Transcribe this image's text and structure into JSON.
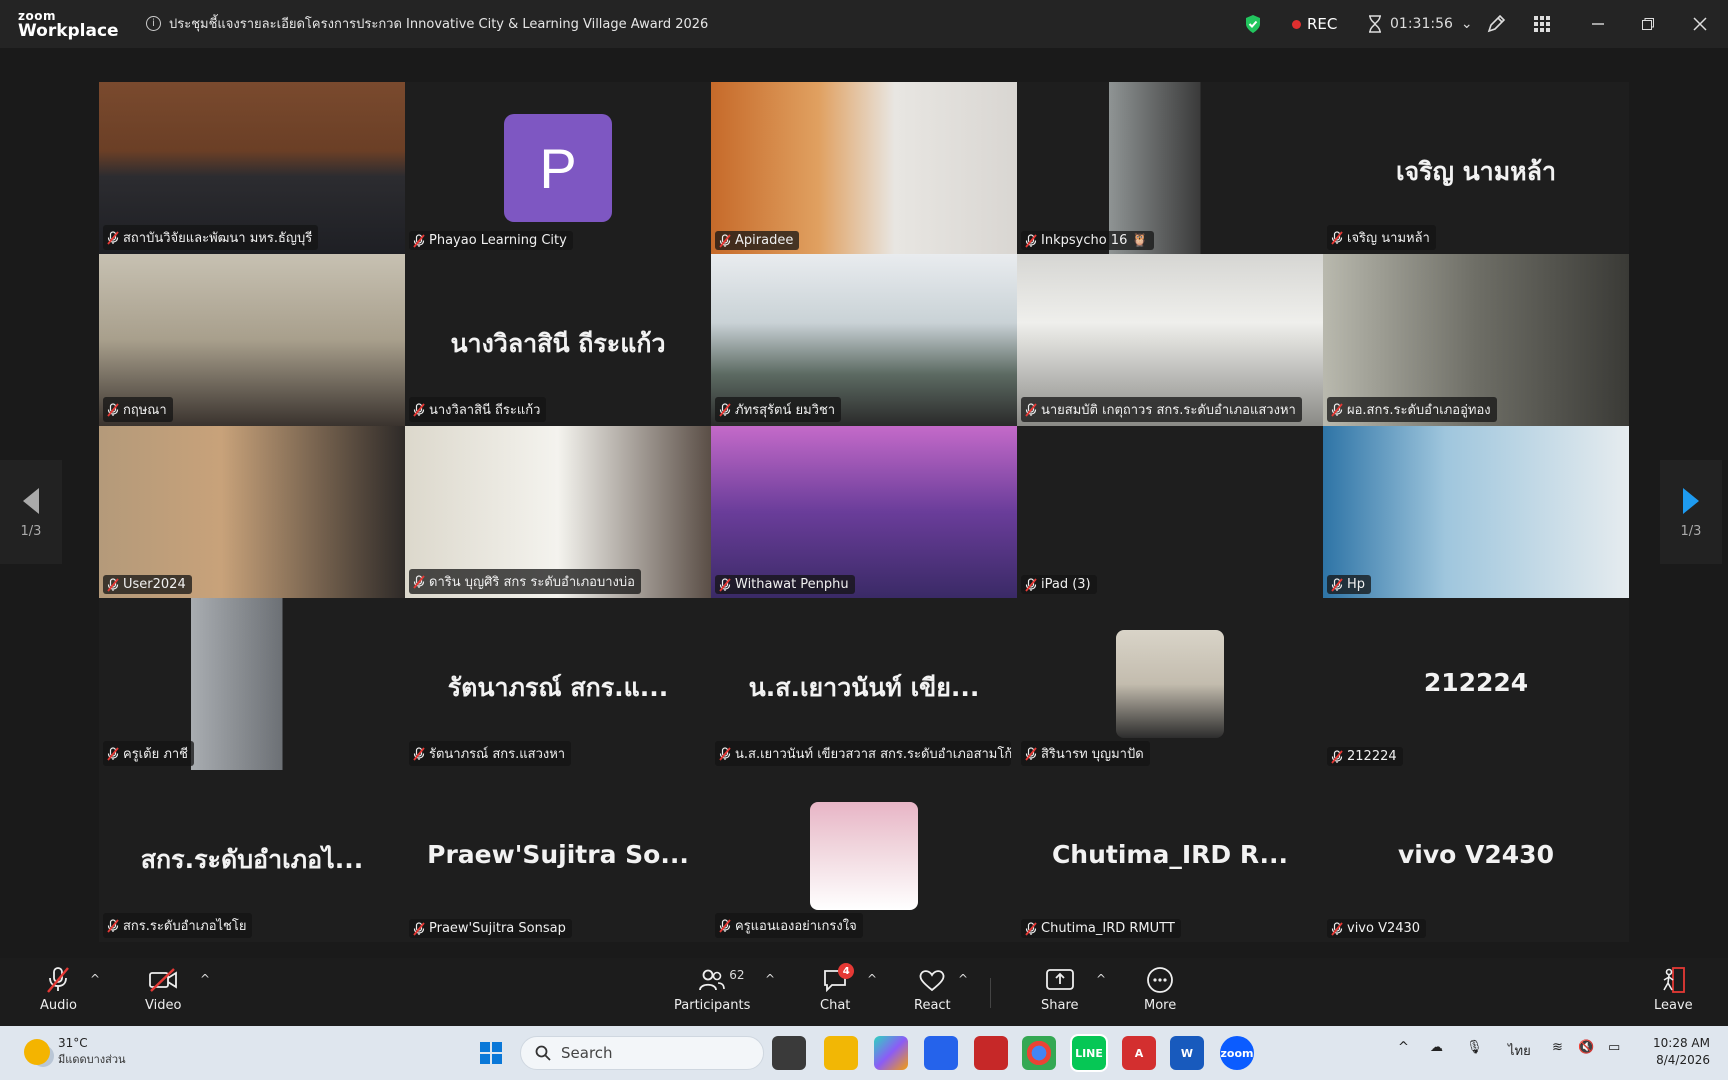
{
  "app": {
    "logo_top": "zoom",
    "logo_bottom": "Workplace"
  },
  "meeting": {
    "title": "ประชุมชี้แจงรายละเอียดโครงการประกวด Innovative City & Learning Village Award 2026"
  },
  "status": {
    "rec_label": "REC",
    "elapsed": "01:31:56"
  },
  "tiles": [
    {
      "label": "สถาบันวิจัยและพัฒนา มหร.ธัญบุรี",
      "big": "",
      "kind": "video",
      "scene": "meeting-room",
      "active": true
    },
    {
      "label": "Phayao Learning City",
      "big": "",
      "kind": "avatar",
      "avatar_letter": "P"
    },
    {
      "label": "Apiradee",
      "big": "",
      "kind": "video",
      "scene": "office-woman"
    },
    {
      "label": "Inkpsycho 16 🦉",
      "big": "",
      "kind": "video",
      "scene": "portrait-room"
    },
    {
      "label": "เจริญ นามหล้า",
      "big": "เจริญ นามหล้า",
      "kind": "name"
    },
    {
      "label": "กฤษณา",
      "big": "",
      "kind": "video",
      "scene": "shelf-woman"
    },
    {
      "label": "นางวิลาสินี  ถีระแก้ว",
      "big": "นางวิลาสินี  ถีระแก้ว",
      "kind": "name"
    },
    {
      "label": "ภัทรสุรัตน์ ยมวิชา",
      "big": "",
      "kind": "video",
      "scene": "office-man"
    },
    {
      "label": "นายสมบัติ  เกตุถาวร สกร.ระดับอำเภอแสวงหา",
      "big": "",
      "kind": "video",
      "scene": "ceiling"
    },
    {
      "label": "ผอ.สกร.ระดับอำเภออู่ทอง",
      "big": "",
      "kind": "video",
      "scene": "man-glasses"
    },
    {
      "label": "User2024",
      "big": "",
      "kind": "video",
      "scene": "closeup-woman"
    },
    {
      "label": "ดาริน บุญศิริ สกร ระดับอำเภอบางบ่อ",
      "big": "",
      "kind": "video",
      "scene": "office-bright"
    },
    {
      "label": "Withawat Penphu",
      "big": "",
      "kind": "video",
      "scene": "banner"
    },
    {
      "label": "iPad (3)",
      "big": "",
      "kind": "blank"
    },
    {
      "label": "Hp",
      "big": "",
      "kind": "video",
      "scene": "blue-room"
    },
    {
      "label": "ครูเต้ย ภาชี",
      "big": "",
      "kind": "video",
      "scene": "phone"
    },
    {
      "label": "รัตนาภรณ์ สกร.แสวงหา",
      "big": "รัตนาภรณ์ สกร.แ...",
      "kind": "name"
    },
    {
      "label": "น.ส.เยาวนันท์ เขียวสวาส สกร.ระดับอำเภอสามโก้",
      "big": "น.ส.เยาวนันท์ เขีย...",
      "kind": "name"
    },
    {
      "label": "สิรินารท บุญมาปัด",
      "big": "",
      "kind": "thumb",
      "scene": "thumb-person"
    },
    {
      "label": "212224",
      "big": "212224",
      "kind": "name"
    },
    {
      "label": "สกร.ระดับอำเภอไชโย",
      "big": "สกร.ระดับอำเภอไ...",
      "kind": "name"
    },
    {
      "label": "Praew'Sujitra Sonsap",
      "big": "Praew'Sujitra  So...",
      "kind": "name"
    },
    {
      "label": "ครูแอนเองอย่าเกรงใจ",
      "big": "",
      "kind": "thumb",
      "scene": "thumb-group"
    },
    {
      "label": "Chutima_IRD RMUTT",
      "big": "Chutima_IRD  R...",
      "kind": "name"
    },
    {
      "label": "vivo V2430",
      "big": "vivo V2430",
      "kind": "name"
    }
  ],
  "pagination": {
    "left": "1/3",
    "right": "1/3"
  },
  "toolbar": {
    "audio": "Audio",
    "video": "Video",
    "participants": "Participants",
    "participants_count": "62",
    "chat": "Chat",
    "chat_badge": "4",
    "react": "React",
    "share": "Share",
    "more": "More",
    "leave": "Leave"
  },
  "taskbar": {
    "temp": "31°C",
    "weather_desc": "มีแดดบางส่วน",
    "search_placeholder": "Search",
    "lang": "ไทย",
    "time": "10:28 AM",
    "date": "8/4/2026"
  },
  "colors": {
    "active_speaker": "#2ecc71",
    "rec": "#e02f2f",
    "avatar": "#7e57c2",
    "nav_arrow": "#1e9bf0"
  }
}
